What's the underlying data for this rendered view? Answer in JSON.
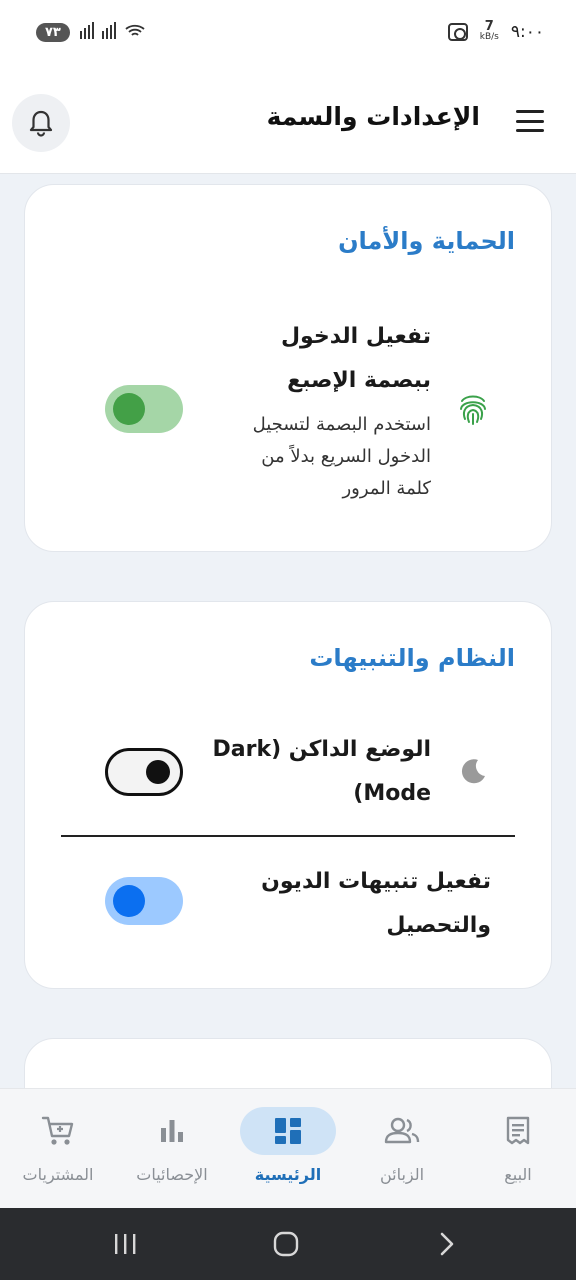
{
  "status_bar": {
    "time": "٩:٠٠",
    "speed_value": "7",
    "speed_unit": "kB/s",
    "battery": "٧٣"
  },
  "header": {
    "title": "الإعدادات والسمة",
    "icons": {
      "menu": "hamburger-icon",
      "notifications": "bell-icon"
    }
  },
  "security_card": {
    "title": "الحماية والأمان",
    "fingerprint": {
      "title": "تفعيل الدخول ببصمة الإصبع",
      "description": "استخدم البصمة لتسجيل الدخول السريع بدلاً من كلمة المرور",
      "enabled": true,
      "icon": "fingerprint-icon"
    }
  },
  "system_card": {
    "title": "النظام والتنبيهات",
    "dark_mode": {
      "title": "الوضع الداكن (Dark Mode)",
      "enabled": false,
      "icon": "moon-icon"
    },
    "debt_alerts": {
      "title": "تفعيل تنبيهات الديون والتحصيل",
      "enabled": true
    }
  },
  "bottom_nav": {
    "items": [
      {
        "label": "البيع",
        "icon": "receipt-icon",
        "active": false
      },
      {
        "label": "الزبائن",
        "icon": "users-icon",
        "active": false
      },
      {
        "label": "الرئيسية",
        "icon": "dashboard-icon",
        "active": true
      },
      {
        "label": "الإحصائيات",
        "icon": "bar-chart-icon",
        "active": false
      },
      {
        "label": "المشتريات",
        "icon": "cart-icon",
        "active": false
      }
    ]
  },
  "colors": {
    "accent": "#2b7cc8",
    "toggle_green": "#43a047",
    "toggle_blue": "#0b6ff0",
    "background": "#eef2f7"
  }
}
